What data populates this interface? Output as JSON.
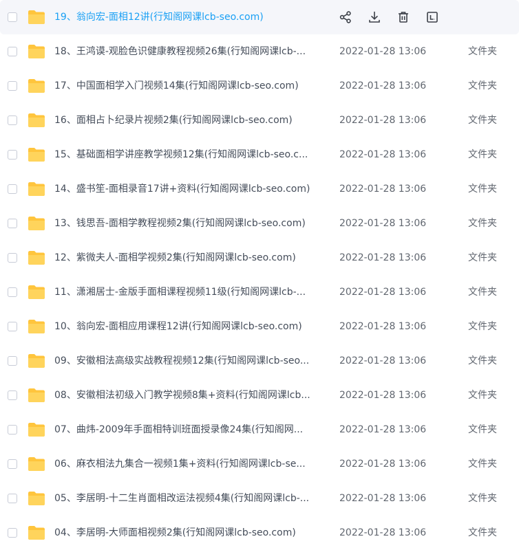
{
  "file_list": {
    "rows": [
      {
        "name": "19、翁向宏-面相12讲(行知阁网课lcb-seo.com)",
        "date": "",
        "type": "",
        "hovered": true
      },
      {
        "name": "18、王鸿谟-观脸色识健康教程视频26集(行知阁网课lcb-...",
        "date": "2022-01-28 13:06",
        "type": "文件夹"
      },
      {
        "name": "17、中国面相学入门视频14集(行知阁网课lcb-seo.com)",
        "date": "2022-01-28 13:06",
        "type": "文件夹"
      },
      {
        "name": "16、面相占卜纪录片视频2集(行知阁网课lcb-seo.com)",
        "date": "2022-01-28 13:06",
        "type": "文件夹"
      },
      {
        "name": "15、基础面相学讲座教学视频12集(行知阁网课lcb-seo.c...",
        "date": "2022-01-28 13:06",
        "type": "文件夹"
      },
      {
        "name": "14、盛书笙-面相录音17讲+资料(行知阁网课lcb-seo.com)",
        "date": "2022-01-28 13:06",
        "type": "文件夹"
      },
      {
        "name": "13、钱思吾-面相学教程视频2集(行知阁网课lcb-seo.com)",
        "date": "2022-01-28 13:06",
        "type": "文件夹"
      },
      {
        "name": "12、紫微夫人-面相学视频2集(行知阁网课lcb-seo.com)",
        "date": "2022-01-28 13:06",
        "type": "文件夹"
      },
      {
        "name": "11、潇湘居士-金版手面相课程视频11级(行知阁网课lcb-...",
        "date": "2022-01-28 13:06",
        "type": "文件夹"
      },
      {
        "name": "10、翁向宏-面相应用课程12讲(行知阁网课lcb-seo.com)",
        "date": "2022-01-28 13:06",
        "type": "文件夹"
      },
      {
        "name": "09、安徽相法高级实战教程视频12集(行知阁网课lcb-seo...",
        "date": "2022-01-28 13:06",
        "type": "文件夹"
      },
      {
        "name": "08、安徽相法初级入门教学视频8集+资料(行知阁网课lcb...",
        "date": "2022-01-28 13:06",
        "type": "文件夹"
      },
      {
        "name": "07、曲炜-2009年手面相特训班面授录像24集(行知阁网...",
        "date": "2022-01-28 13:06",
        "type": "文件夹"
      },
      {
        "name": "06、麻衣相法九集合一视频1集+资料(行知阁网课lcb-se...",
        "date": "2022-01-28 13:06",
        "type": "文件夹"
      },
      {
        "name": "05、李居明-十二生肖面相改运法视频4集(行知阁网课lcb-...",
        "date": "2022-01-28 13:06",
        "type": "文件夹"
      },
      {
        "name": "04、李居明-大师面相视频2集(行知阁网课lcb-seo.com)",
        "date": "2022-01-28 13:06",
        "type": "文件夹"
      }
    ]
  },
  "icons": {
    "folder": "folder-icon",
    "share": "share-icon",
    "download": "download-icon",
    "delete": "trash-icon",
    "more": "rename-icon"
  },
  "colors": {
    "folder": "#ffc53d",
    "hover_text": "#1aa0f4",
    "hover_bg": "#f5f6fa",
    "text": "#454d5a",
    "muted": "#60666f"
  }
}
